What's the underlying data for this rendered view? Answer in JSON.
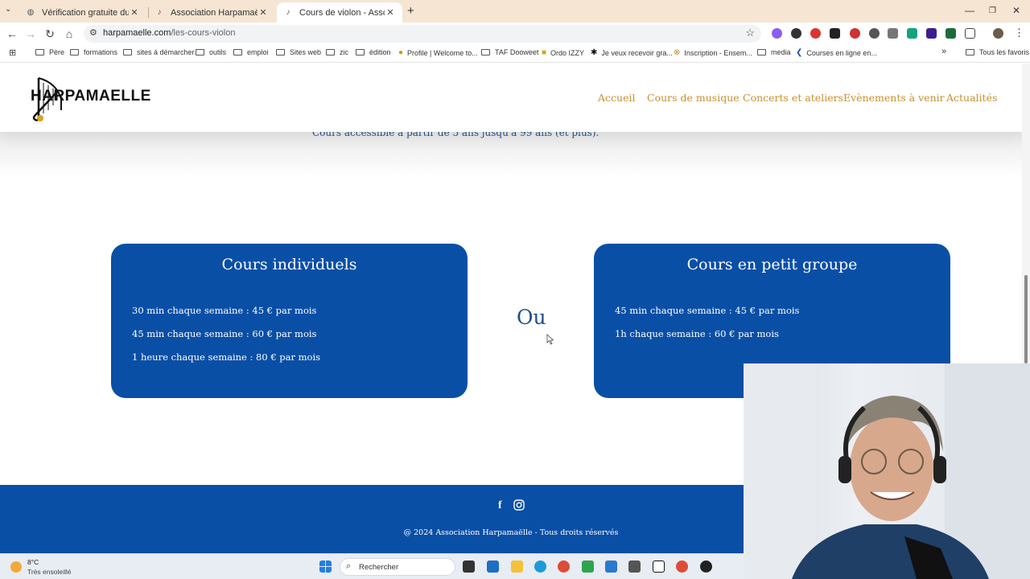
{
  "browser": {
    "tabs": [
      {
        "title": "Vérification gratuite du classem",
        "active": false
      },
      {
        "title": "Association Harpamaëlle -",
        "active": false
      },
      {
        "title": "Cours de violon - Association H",
        "active": true
      }
    ],
    "new_tab": "+",
    "url_host": "harpamaelle.com",
    "url_path": "/les-cours-violon"
  },
  "bookmarks": [
    {
      "label": "Père",
      "type": "folder"
    },
    {
      "label": "formations",
      "type": "folder"
    },
    {
      "label": "sites à démarcher",
      "type": "folder"
    },
    {
      "label": "outils",
      "type": "folder"
    },
    {
      "label": "emploi",
      "type": "folder"
    },
    {
      "label": "Sites web",
      "type": "folder"
    },
    {
      "label": "zic",
      "type": "folder"
    },
    {
      "label": "édition",
      "type": "folder"
    },
    {
      "label": "Profile | Welcome to...",
      "type": "link"
    },
    {
      "label": "TAF Dooweet",
      "type": "folder"
    },
    {
      "label": "Ordo IZZY",
      "type": "link"
    },
    {
      "label": "Je veux recevoir gra...",
      "type": "link"
    },
    {
      "label": "Inscription - Ensem...",
      "type": "link"
    },
    {
      "label": "media",
      "type": "folder"
    },
    {
      "label": "Courses en ligne en...",
      "type": "link"
    }
  ],
  "bookmarks_more": "»",
  "all_bookmarks": "Tous les favoris",
  "site": {
    "logo_text": "HARPAMAELLE",
    "menu": [
      "Accueil",
      "Cours de musique",
      "Concerts et ateliers",
      "Evènements à venir",
      "Actualités"
    ],
    "age_note": "Cours accessible à partir de 5 ans jusqu'à 99 ans (et plus).",
    "card_individual": {
      "title": "Cours individuels",
      "lines": [
        "30 min chaque semaine : 45 € par mois",
        "45 min chaque semaine : 60 € par mois",
        "1 heure chaque semaine : 80 € par mois"
      ]
    },
    "separator": "Ou",
    "card_group": {
      "title": "Cours en petit groupe",
      "lines": [
        "45 min chaque semaine : 45 € par mois",
        "1h chaque semaine : 60 € par mois"
      ]
    },
    "footer_copyright": "@ 2024 Association Harpamaëlle - Tous droits réservés"
  },
  "taskbar": {
    "temperature": "8°C",
    "weather": "Très ensoleillé",
    "search_placeholder": "Rechercher"
  },
  "colors": {
    "brand_blue": "#0a4fa6",
    "menu_gold": "#c8902e",
    "tabstrip": "#f6e5d2"
  }
}
